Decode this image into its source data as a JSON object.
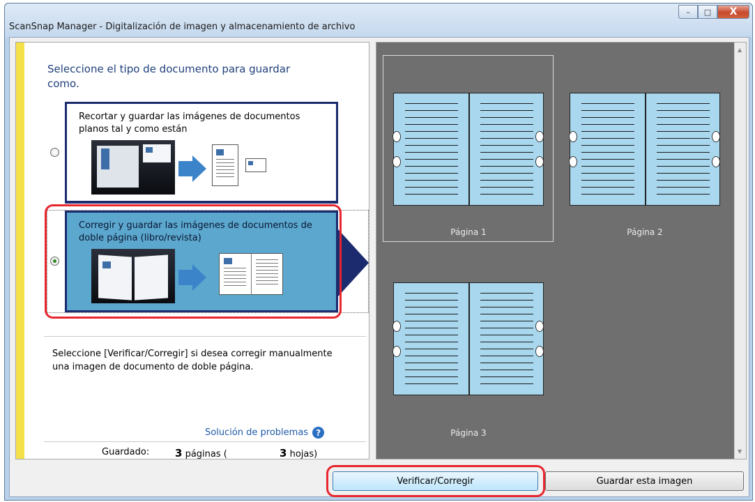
{
  "window": {
    "title": "ScanSnap Manager - Digitalización de imagen y almacenamiento de archivo",
    "controls": {
      "minimize": "–",
      "maximize": "□",
      "close": "X"
    }
  },
  "left_panel": {
    "prompt": "Seleccione el tipo de documento para guardar como.",
    "options": [
      {
        "label": "Recortar y guardar las imágenes de documentos planos tal y como están",
        "selected": false
      },
      {
        "label": "Corregir y guardar las imágenes de documentos de doble página (libro/revista)",
        "selected": true
      }
    ],
    "help_text": "Seleccione [Verificar/Corregir] si desea corregir manualmente una imagen de documento de doble página.",
    "troubleshooting_link": "Solución de problemas",
    "saved": {
      "label": "Guardado:",
      "pages_count": "3",
      "pages_text": "páginas (",
      "sheets_count": "3",
      "sheets_text": "hojas)"
    }
  },
  "right_panel": {
    "pages": [
      {
        "label": "Página 1",
        "selected": true
      },
      {
        "label": "Página 2",
        "selected": false
      },
      {
        "label": "Página 3",
        "selected": false
      }
    ]
  },
  "buttons": {
    "verify": "Verificar/Corregir",
    "save_image": "Guardar esta imagen"
  },
  "colors": {
    "selected_option": "#5ba7ce",
    "option_border": "#1c2b6e",
    "highlight": "#e8262d",
    "thumbnail_bg": "#6f6f6f",
    "page_fill": "#a8d7ee"
  }
}
